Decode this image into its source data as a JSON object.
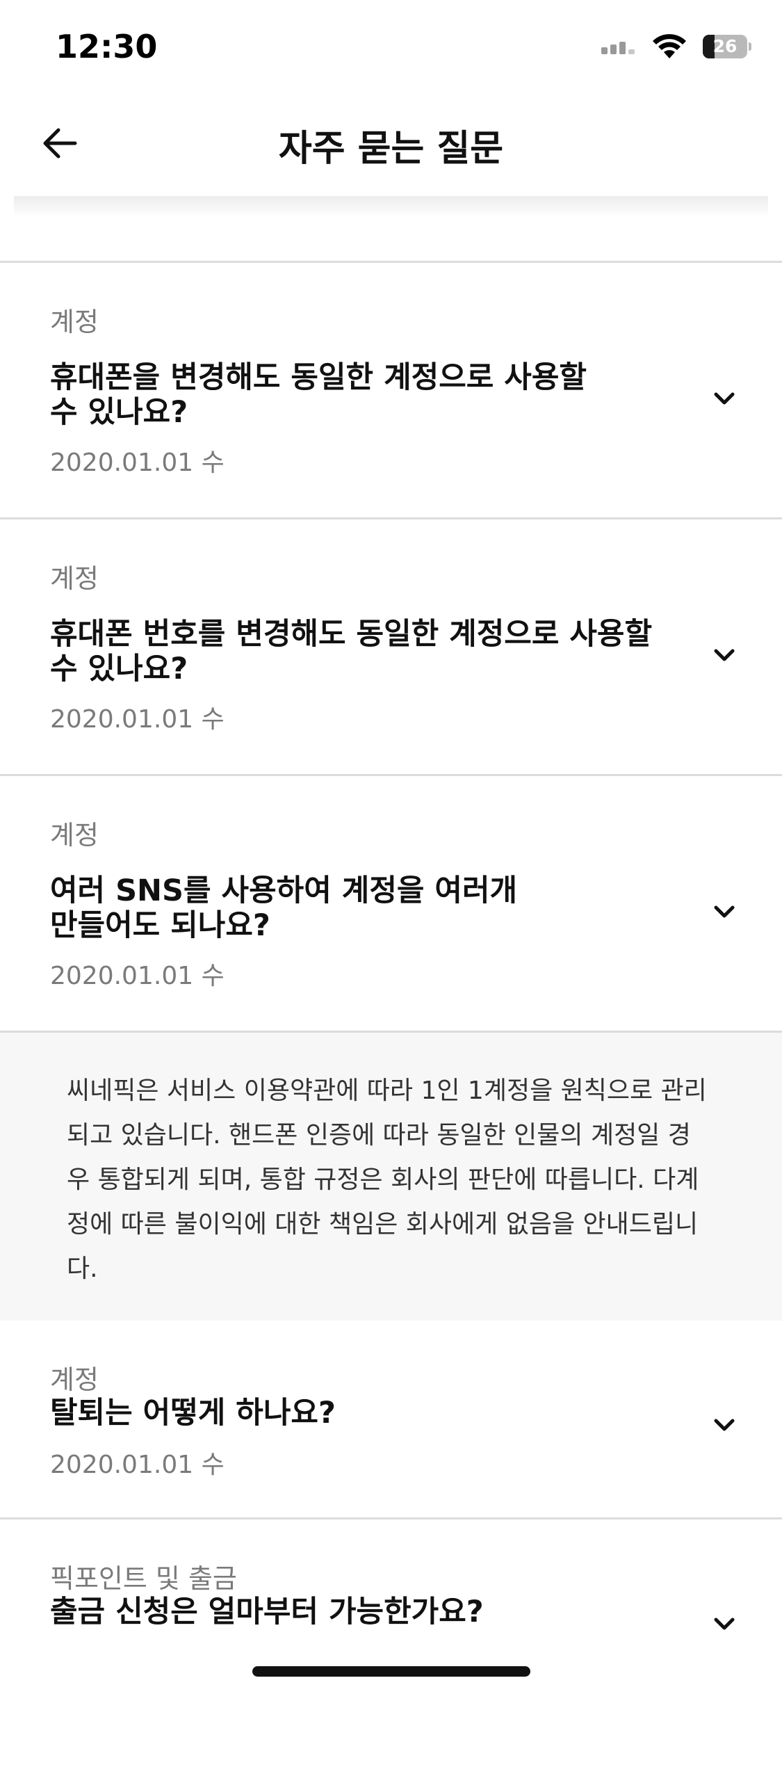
{
  "status_bar": {
    "time": "12:30",
    "battery_level": "26",
    "battery_fraction": 0.26
  },
  "header": {
    "title": "자주 묻는 질문",
    "back_icon": "arrow-left-icon"
  },
  "faq_items": [
    {
      "category": "계정",
      "question": "휴대폰을 변경해도 동일한 계정으로 사용할 수 있나요?",
      "date": "2020.01.01 수"
    },
    {
      "category": "계정",
      "question": "휴대폰 번호를 변경해도 동일한 계정으로 사용할 수 있나요?",
      "date": "2020.01.01 수"
    },
    {
      "category": "계정",
      "question": "여러 SNS를 사용하여 계정을 여러개 만들어도 되나요?",
      "date": "2020.01.01 수",
      "expanded": true,
      "answer": "씨네픽은 서비스 이용약관에 따라 1인 1계정을 원칙으로 관리되고 있습니다. 핸드폰 인증에 따라 동일한 인물의 계정일 경우 통합되게 되며, 통합 규정은 회사의 판단에 따릅니다. 다계정에 따른 불이익에 대한 책임은 회사에게 없음을 안내드립니다."
    },
    {
      "category": "계정",
      "question": "탈퇴는 어떻게 하나요?",
      "date": "2020.01.01 수"
    },
    {
      "category": "픽포인트 및 출금",
      "question": "출금 신청은 얼마부터 가능한가요?"
    }
  ],
  "icons": {
    "chevron": "chevron-down-icon",
    "signal": "cellular-signal-icon",
    "wifi": "wifi-icon",
    "battery": "battery-icon"
  }
}
